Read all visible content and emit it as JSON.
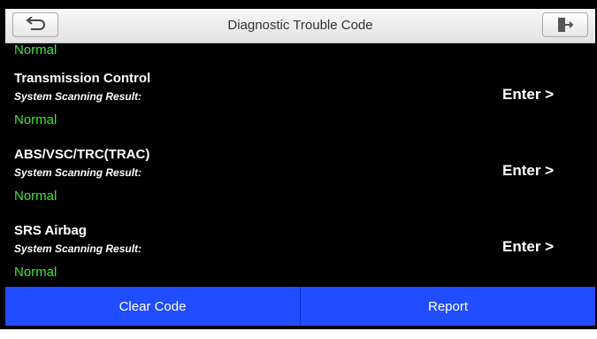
{
  "header": {
    "title": "Diagnostic Trouble Code",
    "back_icon": "back-arrow-icon",
    "exit_icon": "exit-door-icon"
  },
  "list": {
    "top_status": "Normal",
    "items": [
      {
        "name": "Transmission Control",
        "sub": "System Scanning Result:",
        "status": "Normal",
        "enter": "Enter >"
      },
      {
        "name": "ABS/VSC/TRC(TRAC)",
        "sub": "System Scanning Result:",
        "status": "Normal",
        "enter": "Enter >"
      },
      {
        "name": "SRS Airbag",
        "sub": "System Scanning Result:",
        "status": "Normal",
        "enter": "Enter >"
      }
    ]
  },
  "footer": {
    "clear_label": "Clear Code",
    "report_label": "Report"
  },
  "colors": {
    "status_green": "#41e23c",
    "footer_blue": "#1f4dff",
    "background": "#000000"
  }
}
